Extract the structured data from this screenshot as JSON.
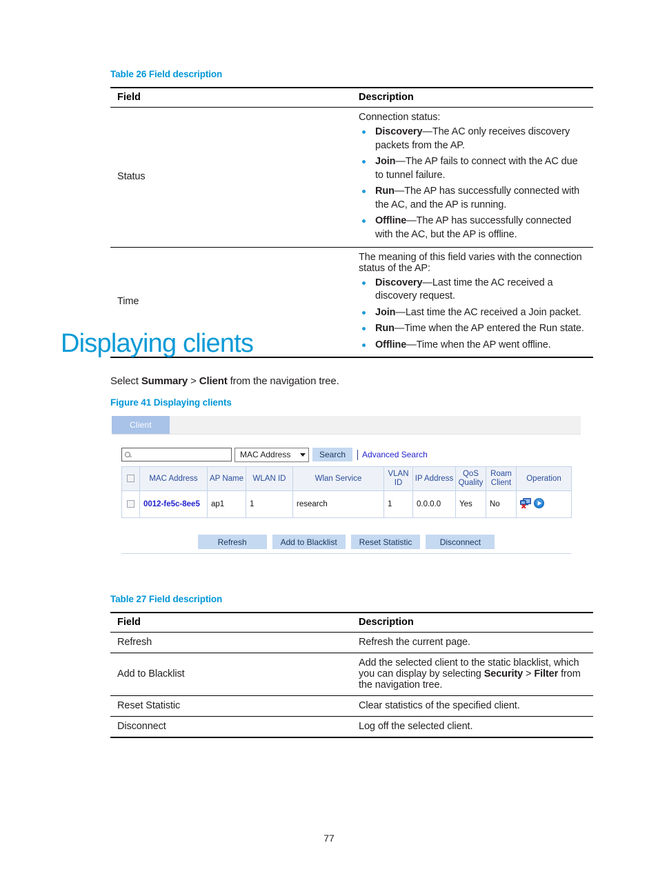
{
  "colors": {
    "caption_blue": "#0096d6",
    "heading_blue": "#0b9ad6",
    "link_blue": "#2222cc",
    "grid_header_blue": "#2a4c9b",
    "button_fill": "#c5d9f1",
    "tab_fill": "#a8c2e8",
    "bullet_blue": "#1f9ad6"
  },
  "table26": {
    "caption": "Table 26 Field description",
    "headers": {
      "field": "Field",
      "description": "Description"
    },
    "rows": [
      {
        "field": "Status",
        "lead": "Connection status:",
        "bullets": [
          {
            "term": "Discovery",
            "dash": "—",
            "text": "The AC only receives discovery packets from the AP."
          },
          {
            "term": "Join",
            "dash": "—",
            "text": "The AP fails to connect with the AC due to tunnel failure."
          },
          {
            "term": "Run",
            "dash": "—",
            "text": "The AP has successfully connected with the AC, and the AP is running."
          },
          {
            "term": "Offline",
            "dash": "—",
            "text": "The AP has successfully connected with the AC, but  the AP is offline."
          }
        ]
      },
      {
        "field": "Time",
        "lead": "The meaning of this field varies with the connection status of the AP:",
        "bullets": [
          {
            "term": "Discovery",
            "dash": "—",
            "text": "Last time the AC received a discovery request."
          },
          {
            "term": "Join",
            "dash": "—",
            "text": "Last time the AC received a Join packet."
          },
          {
            "term": "Run",
            "dash": "—",
            "text": "Time when the AP entered the Run state."
          },
          {
            "term": "Offline",
            "dash": "—",
            "text": "Time when the AP went offline."
          }
        ]
      }
    ]
  },
  "section": {
    "heading": "Displaying clients",
    "intro": {
      "prefix": "Select ",
      "nav1": "Summary",
      "gt": " > ",
      "nav2": "Client",
      "suffix": " from the navigation tree."
    },
    "figure_caption": "Figure 41 Displaying clients"
  },
  "figure": {
    "tab_label": "Client",
    "search": {
      "input_value": "",
      "input_placeholder": "",
      "search_icon": "search-icon",
      "filter_selected": "MAC Address",
      "filter_options": [
        "MAC Address"
      ],
      "search_button": "Search",
      "separator": "|",
      "advanced_link": "Advanced Search"
    },
    "grid": {
      "columns": [
        "MAC Address",
        "AP Name",
        "WLAN ID",
        "Wlan Service",
        "VLAN ID",
        "IP Address",
        "QoS Quality",
        "Roam Client",
        "Operation"
      ],
      "rows": [
        {
          "selected": false,
          "mac_address": "0012-fe5c-8ee5",
          "ap_name": "ap1",
          "wlan_id": "1",
          "wlan_service": "research",
          "vlan_id": "1",
          "ip_address": "0.0.0.0",
          "qos_quality": "Yes",
          "roam_client": "No",
          "operation_icons": [
            "disconnect-client-icon",
            "play-icon"
          ]
        }
      ]
    },
    "buttons": [
      "Refresh",
      "Add to Blacklist",
      "Reset Statistic",
      "Disconnect"
    ]
  },
  "table27": {
    "caption": "Table 27 Field description",
    "headers": {
      "field": "Field",
      "description": "Description"
    },
    "rows": [
      {
        "field": "Refresh",
        "desc_plain": "Refresh the current page."
      },
      {
        "field": "Add to Blacklist",
        "desc_pre": "Add the selected client to the static blacklist, which you can display by selecting ",
        "desc_nav1": "Security",
        "desc_gt": " > ",
        "desc_nav2": "Filter",
        "desc_post": " from the navigation tree."
      },
      {
        "field": "Reset Statistic",
        "desc_plain": "Clear statistics of the specified client."
      },
      {
        "field": "Disconnect",
        "desc_plain": "Log off the selected client."
      }
    ]
  },
  "footer": {
    "page_number": "77"
  }
}
